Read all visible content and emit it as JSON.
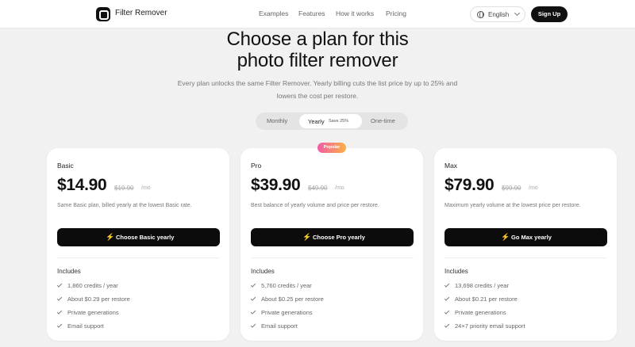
{
  "header": {
    "brand": "Filter Remover",
    "nav": [
      "Examples",
      "Features",
      "How it works",
      "Pricing"
    ],
    "language": "English",
    "signup": "Sign Up"
  },
  "hero": {
    "title_line1": "Choose a plan for this",
    "title_line2": "photo filter remover",
    "subtitle_line1": "Every plan unlocks the same Filter Remover. Yearly billing cuts the list price by up to 25% and",
    "subtitle_line2": "lowers the cost per restore."
  },
  "billing": {
    "monthly": "Monthly",
    "yearly": "Yearly",
    "save": "Save 25%",
    "onetime": "One-time",
    "selected": "Yearly"
  },
  "badge": "Popular",
  "plans": [
    {
      "name": "Basic",
      "price": "$14.90",
      "old_price": "$19.90",
      "per": "/mo",
      "desc": "Same Basic plan, billed yearly at the lowest Basic rate.",
      "cta": "Choose Basic yearly",
      "includes": "Includes",
      "features": [
        "1,860 credits / year",
        "About $0.29 per restore",
        "Private generations",
        "Email support"
      ]
    },
    {
      "name": "Pro",
      "price": "$39.90",
      "old_price": "$49.90",
      "per": "/mo",
      "desc": "Best balance of yearly volume and price per restore.",
      "cta": "Choose Pro yearly",
      "includes": "Includes",
      "features": [
        "5,760 credits / year",
        "About $0.25 per restore",
        "Private generations",
        "Email support"
      ]
    },
    {
      "name": "Max",
      "price": "$79.90",
      "old_price": "$99.90",
      "per": "/mo",
      "desc": "Maximum yearly volume at the lowest price per restore.",
      "cta": "Go Max yearly",
      "includes": "Includes",
      "features": [
        "13,698 credits / year",
        "About $0.21 per restore",
        "Private generations",
        "24×7 priority email support"
      ]
    }
  ]
}
